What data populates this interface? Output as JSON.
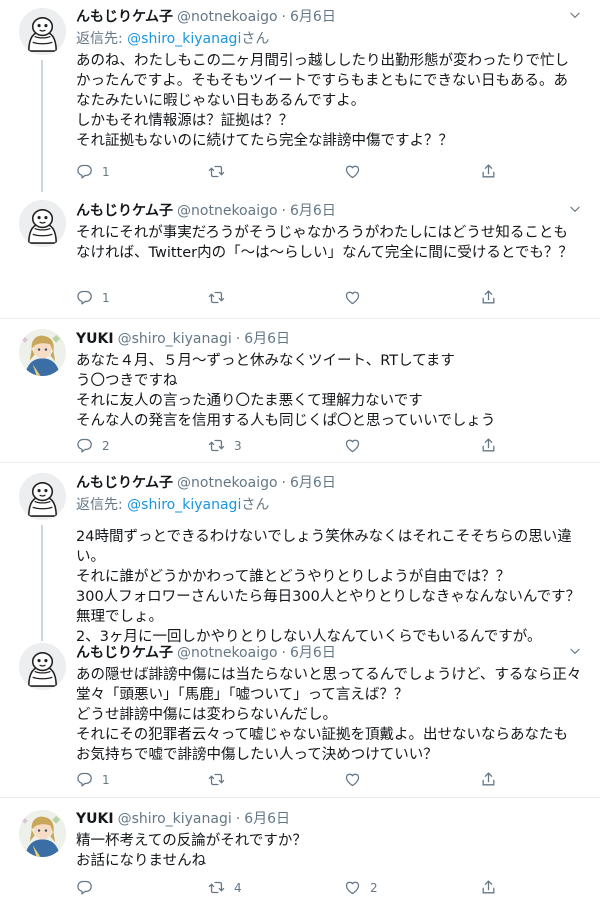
{
  "tweets": [
    {
      "name": "んもじりケム子",
      "handle": "@notnekoaigo",
      "dot": "·",
      "date": "6月6日",
      "replying_prefix": "返信先: ",
      "replying_mention": "@shiro_kiyanagi",
      "replying_suffix": "さん",
      "text": "あのね、わたしもこの二ヶ月間引っ越ししたり出勤形態が変わったりで忙しかったんですよ。そもそもツイートですらもまともにできない日もある。あなたみたいに暇じゃない日もあるんですよ。\nしかもそれ情報源は？証拠は？？\nそれ証拠もないのに続けてたら完全な誹謗中傷ですよ？？",
      "replies": "1",
      "retweets": "",
      "likes": ""
    },
    {
      "name": "んもじりケム子",
      "handle": "@notnekoaigo",
      "dot": "·",
      "date": "6月6日",
      "text": "それにそれが事実だろうがそうじゃなかろうがわたしにはどうせ知ることもなければ、Twitter内の「〜は〜らしい」なんて完全に間に受けるとでも？？",
      "replies": "1",
      "retweets": "",
      "likes": ""
    },
    {
      "name": "YUKI",
      "handle": "@shiro_kiyanagi",
      "dot": "·",
      "date": "6月6日",
      "text": "あなた４月、５月〜ずっと休みなくツイート、RTしてます\nう〇つきですね\nそれに友人の言った通り〇たま悪くて理解力ないです\nそんな人の発言を信用する人も同じくぱ〇と思っていいでしょう",
      "replies": "2",
      "retweets": "3",
      "likes": ""
    },
    {
      "name": "んもじりケム子",
      "handle": "@notnekoaigo",
      "dot": "·",
      "date": "6月6日",
      "replying_prefix": "返信先: ",
      "replying_mention": "@shiro_kiyanagi",
      "replying_suffix": "さん",
      "text": "24時間ずっとできるわけないでしょう笑休みなくはそれこそそちらの思い違い。\nそれに誰がどうかかわって誰とどうやりとりしようが自由では？？\n300人フォロワーさんいたら毎日300人とやりとりしなきゃなんないんです？無理でしょ。\n2、3ヶ月に一回しかやりとりしない人なんていくらでもいるんですが。",
      "replies": "",
      "retweets": "",
      "likes": ""
    },
    {
      "name": "んもじりケム子",
      "handle": "@notnekoaigo",
      "dot": "·",
      "date": "6月6日",
      "text": "あの隠せば誹謗中傷には当たらないと思ってるんでしょうけど、するなら正々堂々「頭悪い」「馬鹿」「嘘ついて」って言えば？？\nどうせ誹謗中傷には変わらないんだし。\nそれにその犯罪者云々って嘘じゃない証拠を頂戴よ。出せないならあなたもお気持ちで嘘で誹謗中傷したい人って決めつけていい？",
      "replies": "1",
      "retweets": "",
      "likes": ""
    },
    {
      "name": "YUKI",
      "handle": "@shiro_kiyanagi",
      "dot": "·",
      "date": "6月6日",
      "text": "精一杯考えての反論がそれですか？\nお話になりませんね",
      "replies": "",
      "retweets": "4",
      "likes": "2"
    }
  ],
  "colors": {
    "text": "#14171a",
    "secondary": "#657786",
    "link": "#1b95e0",
    "thread_line": "#ccd6dd",
    "divider": "#e6ecf0"
  },
  "icons": [
    "reply-icon",
    "retweet-icon",
    "like-icon",
    "share-icon",
    "caret-down-icon",
    "avatar-mascot",
    "avatar-anime"
  ]
}
